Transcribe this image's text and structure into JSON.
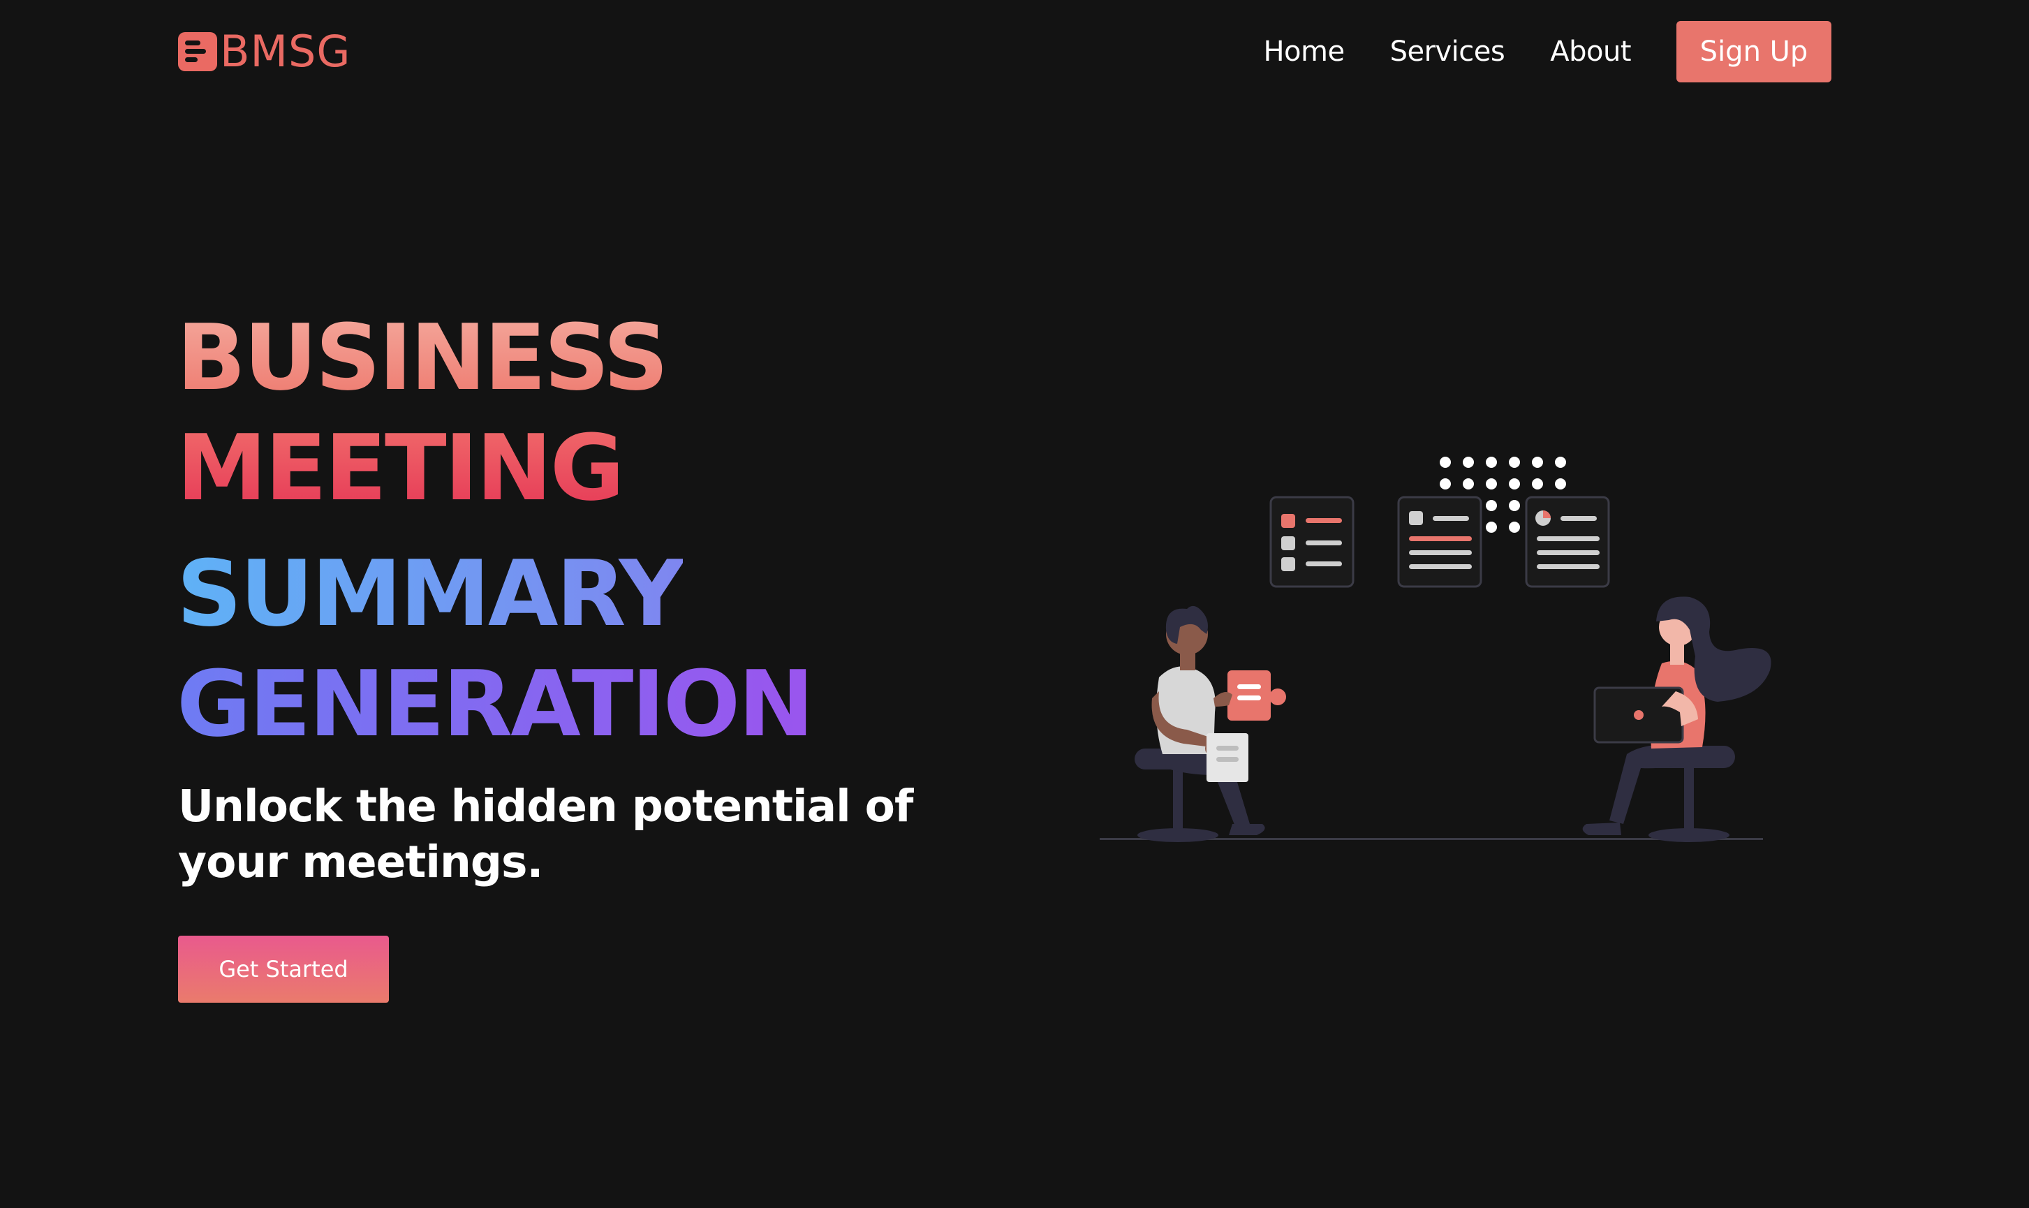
{
  "brand": {
    "name": "BMSG",
    "accent": "#ea6a63"
  },
  "nav": {
    "links": [
      {
        "label": "Home"
      },
      {
        "label": "Services"
      },
      {
        "label": "About"
      }
    ],
    "signup_label": "Sign Up"
  },
  "hero": {
    "lines": [
      "BUSINESS",
      "MEETING",
      "SUMMARY",
      "GENERATION"
    ],
    "tagline": "Unlock the hidden potential of your meetings.",
    "cta_label": "Get Started"
  },
  "colors": {
    "background": "#131313",
    "button": "#e8756c",
    "gradient_warm": [
      "#f4a79b",
      "#e63a57"
    ],
    "gradient_cool": [
      "#5fb2f6",
      "#9a55ee"
    ]
  },
  "illustration": {
    "subject": "two people in a meeting with summary cards"
  }
}
